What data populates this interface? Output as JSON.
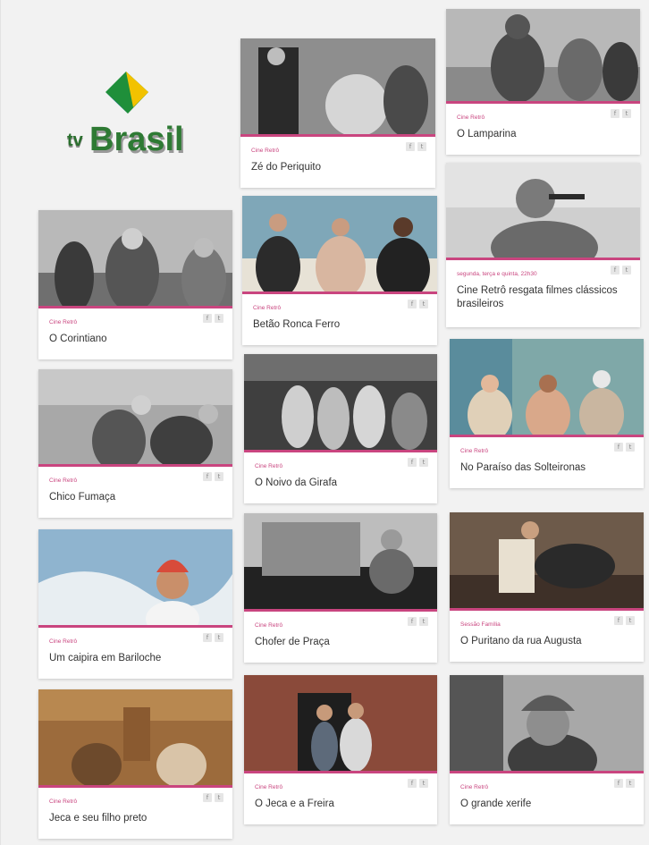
{
  "brand": {
    "tv": "tv",
    "name": "Brasil"
  },
  "share": {
    "facebook": "f",
    "twitter": "🐦"
  },
  "cards": [
    {
      "category": "Cine Retrô",
      "title": "O Corintiano"
    },
    {
      "category": "Cine Retrô",
      "title": "Chico Fumaça"
    },
    {
      "category": "Cine Retrô",
      "title": "Um caipira em Bariloche"
    },
    {
      "category": "Cine Retrô",
      "title": "Jeca e seu filho preto"
    },
    {
      "category": "Cine Retrô",
      "title": "Zé do Periquito"
    },
    {
      "category": "Cine Retrô",
      "title": "Betão Ronca Ferro"
    },
    {
      "category": "Cine Retrô",
      "title": "O Noivo da Girafa"
    },
    {
      "category": "Cine Retrô",
      "title": "Chofer de Praça"
    },
    {
      "category": "Cine Retrô",
      "title": "O Jeca e a Freira"
    },
    {
      "category": "Cine Retrô",
      "title": "O Lamparina"
    },
    {
      "category": "segunda, terça e quinta, 22h30",
      "title": "Cine Retrô resgata filmes clássicos brasileiros"
    },
    {
      "category": "Cine Retrô",
      "title": "No Paraíso das Solteironas"
    },
    {
      "category": "Sessão Família",
      "title": "O Puritano da rua Augusta"
    },
    {
      "category": "Cine Retrô",
      "title": "O grande xerife"
    }
  ]
}
